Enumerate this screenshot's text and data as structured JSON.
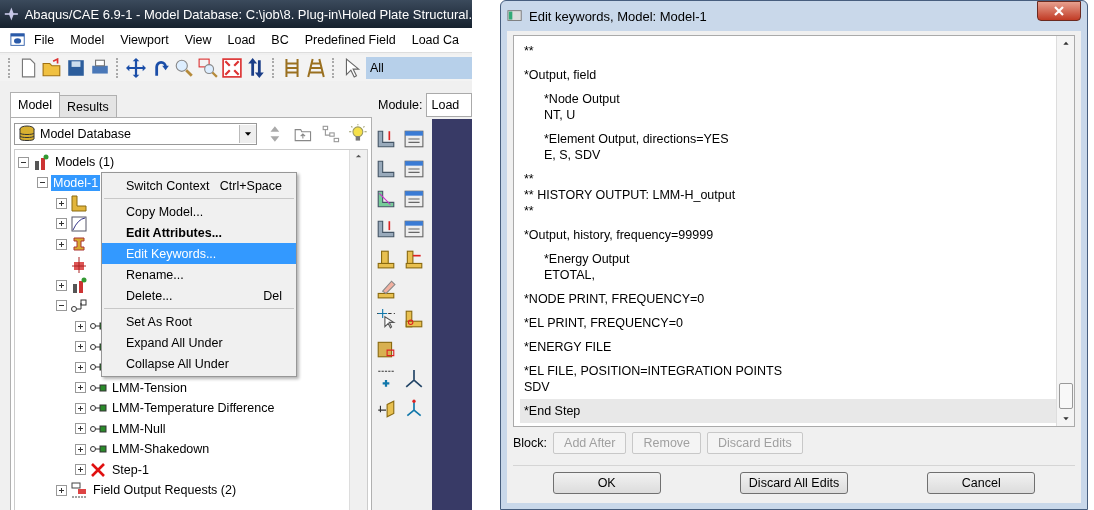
{
  "main_window": {
    "title": "Abaqus/CAE 6.9-1 - Model Database: C:\\job\\8. Plug-in\\Holed Plate Structural.",
    "menu": [
      {
        "label": "File"
      },
      {
        "label": "Model"
      },
      {
        "label": "Viewport"
      },
      {
        "label": "View"
      },
      {
        "label": "Load"
      },
      {
        "label": "BC"
      },
      {
        "label": "Predefined Field"
      },
      {
        "label": "Load Ca"
      }
    ],
    "selection_filter": {
      "value": "All"
    },
    "tabs": [
      {
        "label": "Model",
        "selected": true
      },
      {
        "label": "Results",
        "selected": false
      }
    ],
    "database_combo": {
      "value": "Model Database"
    },
    "module": {
      "label": "Module:",
      "value": "Load"
    },
    "tree": [
      {
        "kind": "models",
        "label": "Models (1)",
        "expanded": true,
        "children": [
          {
            "label": "Model-1",
            "selected": true,
            "expanded": true,
            "children": [
              {
                "kind": "part",
                "expanded": false
              },
              {
                "kind": "material",
                "expanded": false
              },
              {
                "kind": "section",
                "expanded": false
              },
              {
                "kind": "assembly"
              },
              {
                "kind": "models",
                "expanded": false
              },
              {
                "kind": "steps",
                "expanded": true,
                "children": [
                  {
                    "kind": "step",
                    "expanded": false
                  },
                  {
                    "kind": "step",
                    "expanded": false
                  },
                  {
                    "kind": "step",
                    "expanded": false
                  },
                  {
                    "kind": "step",
                    "label": "LMM-Tension",
                    "expanded": false
                  },
                  {
                    "kind": "step",
                    "label": "LMM-Temperature Difference",
                    "expanded": false
                  },
                  {
                    "kind": "step",
                    "label": "LMM-Null",
                    "expanded": false
                  },
                  {
                    "kind": "step",
                    "label": "LMM-Shakedown",
                    "expanded": false
                  },
                  {
                    "kind": "failed-step",
                    "label": "Step-1",
                    "expanded": false
                  }
                ]
              },
              {
                "kind": "output",
                "label": "Field Output Requests (2)",
                "expanded": false
              }
            ]
          }
        ]
      }
    ],
    "context_menu": [
      {
        "kind": "item",
        "label": "Switch Context",
        "shortcut": "Ctrl+Space",
        "bold": false,
        "selected": false
      },
      {
        "kind": "separator"
      },
      {
        "kind": "item",
        "label": "Copy Model...",
        "bold": false,
        "selected": false
      },
      {
        "kind": "item",
        "label": "Edit Attributes...",
        "bold": true,
        "selected": false
      },
      {
        "kind": "item",
        "label": "Edit Keywords...",
        "bold": false,
        "selected": true
      },
      {
        "kind": "item",
        "label": "Rename...",
        "bold": false,
        "selected": false
      },
      {
        "kind": "item",
        "label": "Delete...",
        "shortcut": "Del",
        "bold": false,
        "selected": false
      },
      {
        "kind": "separator"
      },
      {
        "kind": "item",
        "label": "Set As Root",
        "bold": false,
        "selected": false
      },
      {
        "kind": "item",
        "label": "Expand All Under",
        "bold": false,
        "selected": false
      },
      {
        "kind": "item",
        "label": "Collapse All Under",
        "bold": false,
        "selected": false
      }
    ]
  },
  "dialog": {
    "title": "Edit keywords, Model: Model-1",
    "blocks": [
      {
        "lines": [
          "**"
        ],
        "indented": false,
        "selected": false
      },
      {
        "lines": [
          "*Output, field"
        ],
        "indented": false,
        "selected": false
      },
      {
        "lines": [
          "*Node Output",
          "NT, U"
        ],
        "indented": true,
        "selected": false
      },
      {
        "lines": [
          "*Element Output, directions=YES",
          "E, S, SDV"
        ],
        "indented": true,
        "selected": false
      },
      {
        "lines": [
          "**",
          "** HISTORY OUTPUT: LMM-H_output",
          "**"
        ],
        "indented": false,
        "selected": false
      },
      {
        "lines": [
          "*Output, history, frequency=99999"
        ],
        "indented": false,
        "selected": false
      },
      {
        "lines": [
          "*Energy Output",
          "ETOTAL,"
        ],
        "indented": true,
        "selected": false
      },
      {
        "lines": [
          "*NODE PRINT, FREQUENCY=0"
        ],
        "indented": false,
        "selected": false
      },
      {
        "lines": [
          "*EL PRINT, FREQUENCY=0"
        ],
        "indented": false,
        "selected": false
      },
      {
        "lines": [
          "*ENERGY FILE"
        ],
        "indented": false,
        "selected": false
      },
      {
        "lines": [
          "*EL FILE, POSITION=INTEGRATION POINTS",
          "SDV"
        ],
        "indented": false,
        "selected": false
      },
      {
        "lines": [
          "*End Step"
        ],
        "indented": false,
        "selected": true
      }
    ],
    "block_label": "Block:",
    "block_buttons": [
      {
        "label": "Add After",
        "disabled": true
      },
      {
        "label": "Remove",
        "disabled": true
      },
      {
        "label": "Discard Edits",
        "disabled": true
      }
    ],
    "buttons": [
      {
        "label": "OK"
      },
      {
        "label": "Discard All Edits"
      },
      {
        "label": "Cancel"
      }
    ]
  }
}
